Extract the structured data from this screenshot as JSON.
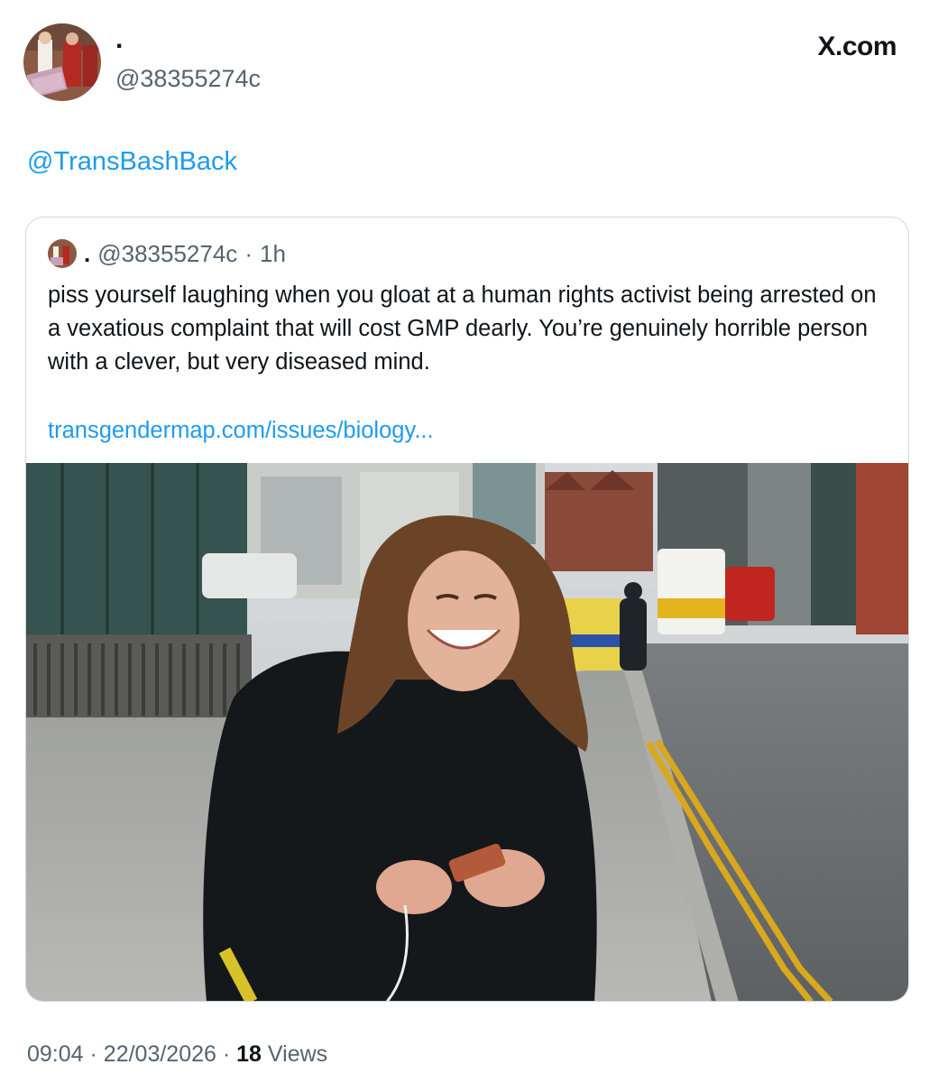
{
  "author": {
    "display_name": ".",
    "handle": "@38355274c"
  },
  "brand": {
    "label": "X.com"
  },
  "tweet": {
    "reply_mention": "@TransBashBack"
  },
  "quoted_tweet": {
    "display_name": ".",
    "handle": "@38355274c",
    "separator": "·",
    "time": "1h",
    "text": "piss yourself laughing when you gloat at a human rights activist being arrested on a vexatious complaint that will cost GMP dearly.  You’re genuinely horrible person with a clever, but very diseased mind.",
    "link": "transgendermap.com/issues/biology..."
  },
  "footer": {
    "time": "09:04",
    "separator1": "·",
    "date": "22/03/2026",
    "separator2": "·",
    "views_count": "18",
    "views_label": "Views"
  },
  "colors": {
    "link": "#1d9bf0",
    "secondary_text": "#536471",
    "primary_text": "#0f1419",
    "border": "#cfd9de"
  }
}
